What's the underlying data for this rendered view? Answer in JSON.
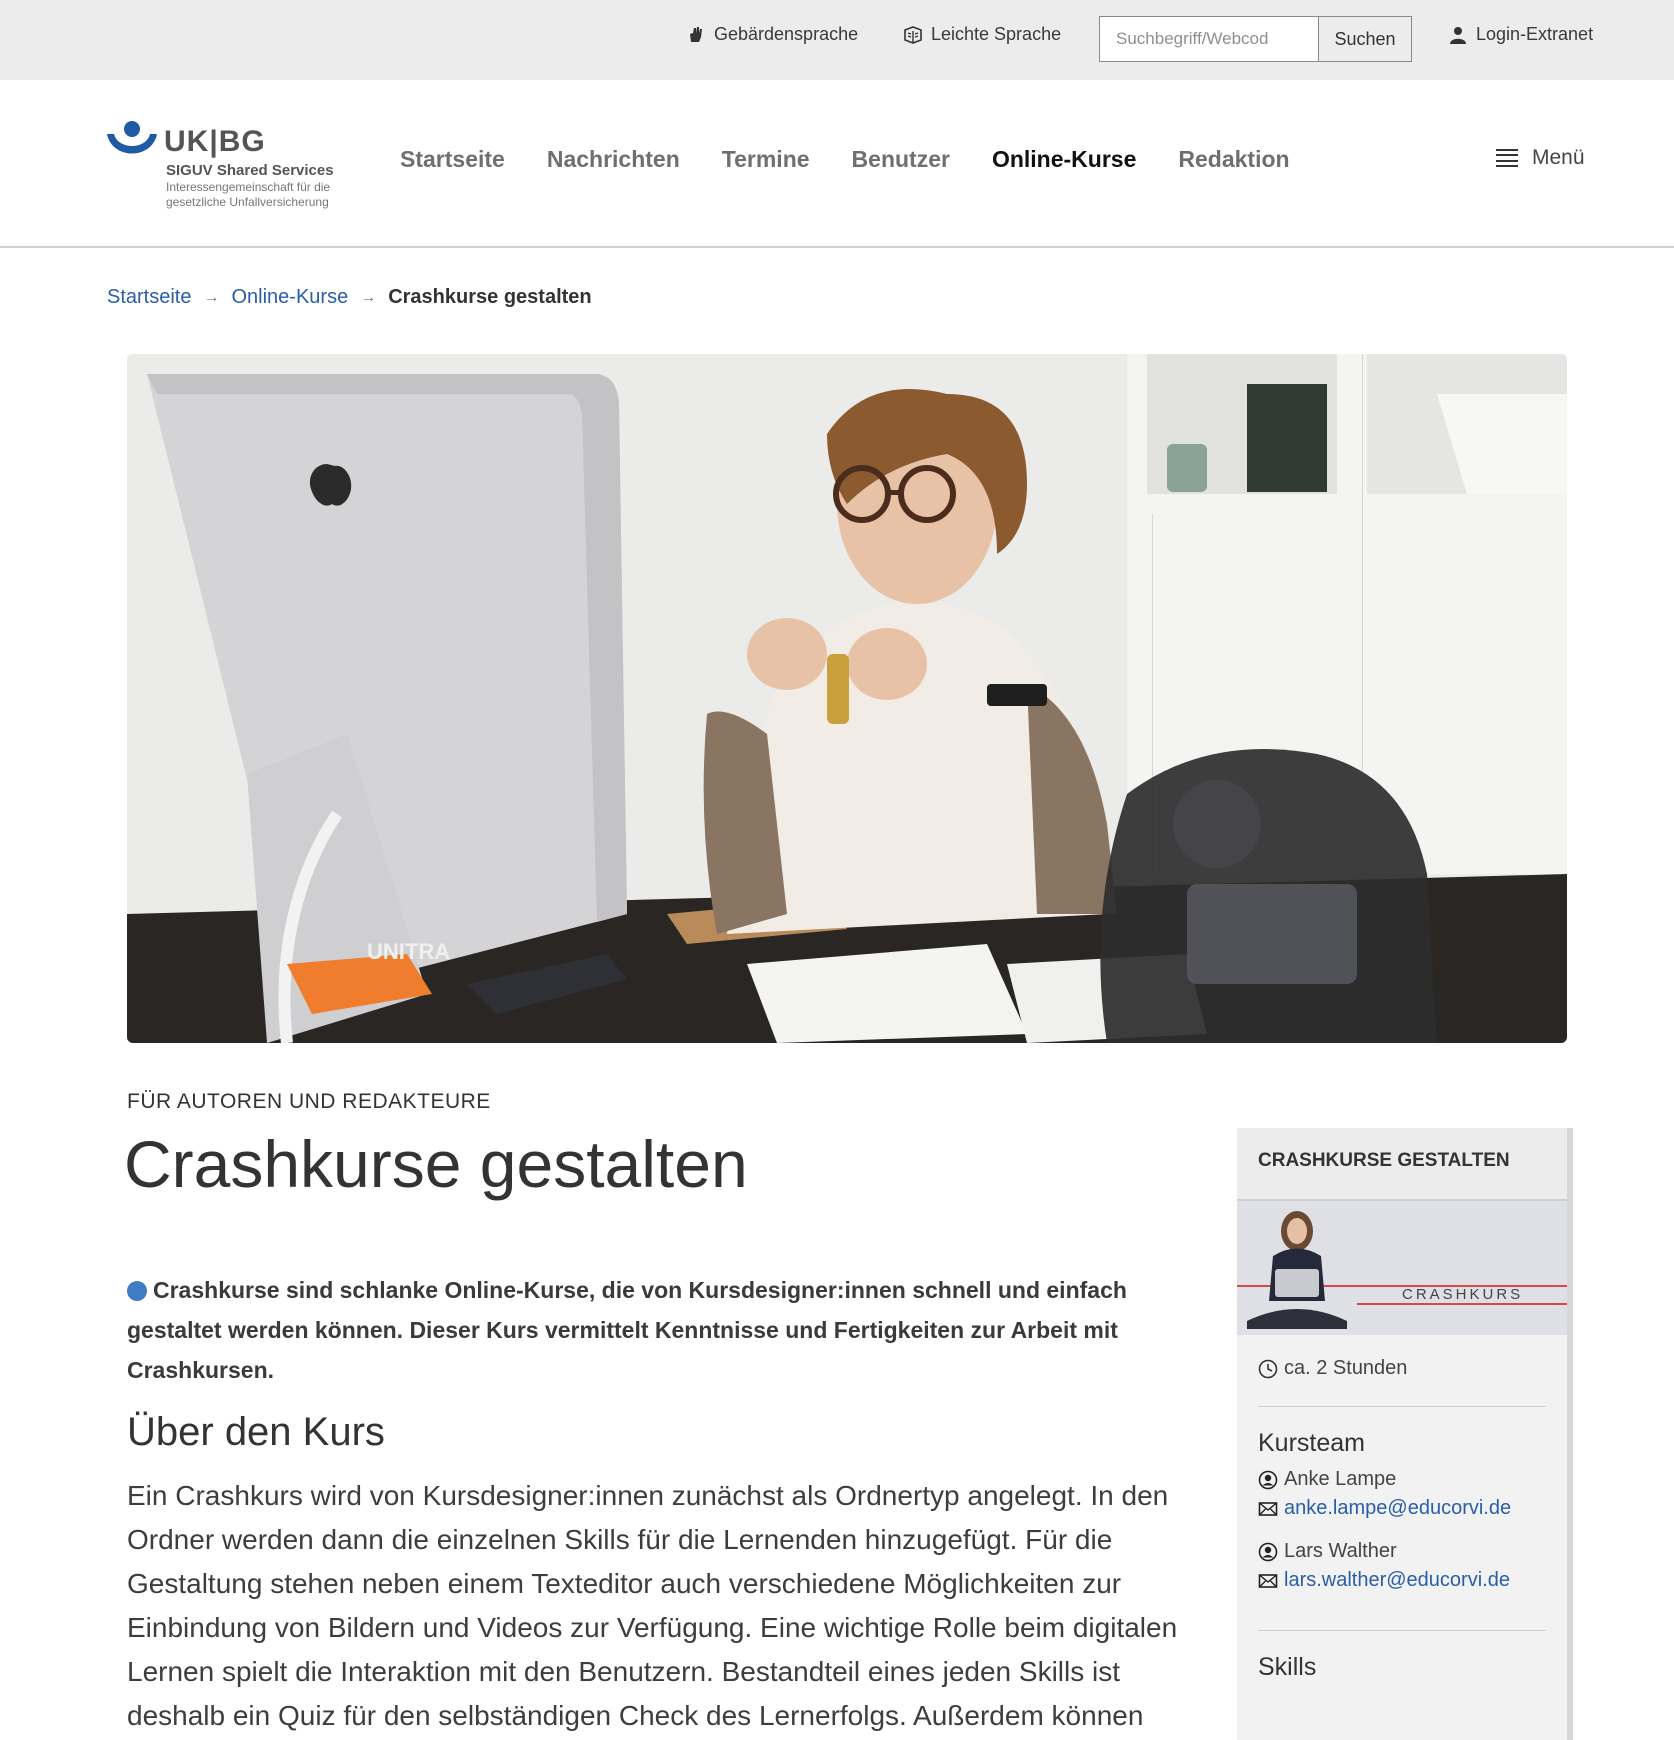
{
  "topbar": {
    "sign_language": "Gebärdensprache",
    "easy_language": "Leichte Sprache",
    "search_placeholder": "Suchbegriff/Webcod",
    "search_button": "Suchen",
    "login": "Login-Extranet"
  },
  "logo": {
    "abbr": "UK|BG",
    "line1": "SIGUV Shared Services",
    "line2": "Interessengemeinschaft für die",
    "line3": "gesetzliche Unfallversicherung"
  },
  "nav": {
    "items": [
      "Startseite",
      "Nachrichten",
      "Termine",
      "Benutzer",
      "Online-Kurse",
      "Redaktion"
    ],
    "active": "Online-Kurse",
    "menu_label": "Menü"
  },
  "breadcrumb": {
    "items": [
      "Startseite",
      "Online-Kurse"
    ],
    "current": "Crashkurse gestalten"
  },
  "hero": {
    "monitor_brand_text": "UNITRA"
  },
  "article": {
    "kicker": "FÜR AUTOREN UND REDAKTEURE",
    "title": "Crashkurse gestalten",
    "lead": "Crashkurse sind schlanke Online-Kurse, die von Kursdesigner:innen schnell und einfach gestaltet werden können. Dieser Kurs vermittelt Kenntnisse und Fertigkeiten zur Arbeit mit Crashkursen.",
    "section_heading": "Über den Kurs",
    "body": "Ein Crashkurs wird von Kursdesigner:innen zunächst als Ordnertyp angelegt. In den Ordner werden dann die einzelnen Skills für die Lernenden hinzugefügt. Für die Gestaltung stehen neben einem Texteditor auch verschiedene Möglichkeiten zur Einbindung von Bildern und Videos zur Verfügung. Eine wichtige Rolle beim digitalen Lernen spielt die Interaktion mit den Benutzern. Bestandteil eines jeden Skills ist deshalb ein Quiz für den selbständigen Check des Lernerfolgs. Außerdem können"
  },
  "sidebar": {
    "heading": "CRASHKURSE GESTALTEN",
    "image_caption": "CRASHKURS",
    "duration": "ca. 2 Stunden",
    "team_heading": "Kursteam",
    "team": [
      {
        "name": "Anke Lampe",
        "email": "anke.lampe@educorvi.de"
      },
      {
        "name": "Lars Walther",
        "email": "lars.walther@educorvi.de"
      }
    ],
    "skills_heading": "Skills"
  },
  "colors": {
    "link": "#2a5ea8",
    "accent_dot": "#3f7cc4",
    "logo_blue": "#1f5aa6",
    "sidebar_red_line": "#d84a4a"
  }
}
